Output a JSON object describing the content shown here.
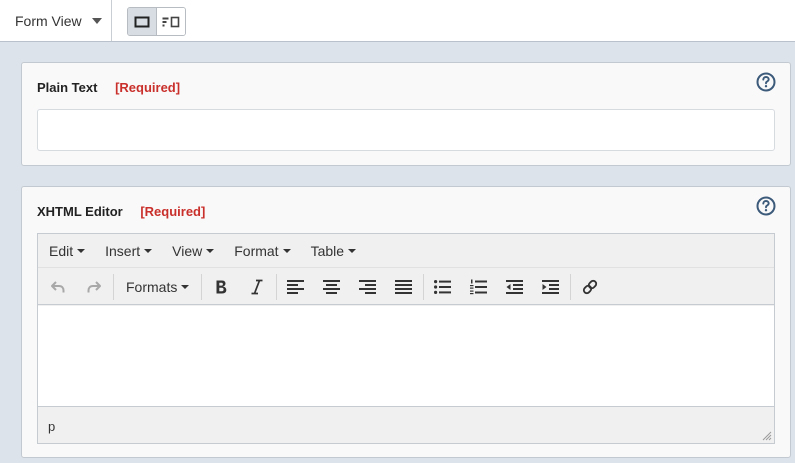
{
  "topbar": {
    "view_select": "Form View"
  },
  "fields": [
    {
      "label": "Plain Text",
      "required": "[Required]",
      "value": "",
      "placeholder": ""
    },
    {
      "label": "XHTML Editor",
      "required": "[Required]"
    }
  ],
  "editor": {
    "menus": [
      "Edit",
      "Insert",
      "View",
      "Format",
      "Table"
    ],
    "formats_label": "Formats",
    "status_path": "p"
  },
  "colors": {
    "required": "#c9302c",
    "help": "#3c5a7a",
    "background": "#dde3ea"
  }
}
